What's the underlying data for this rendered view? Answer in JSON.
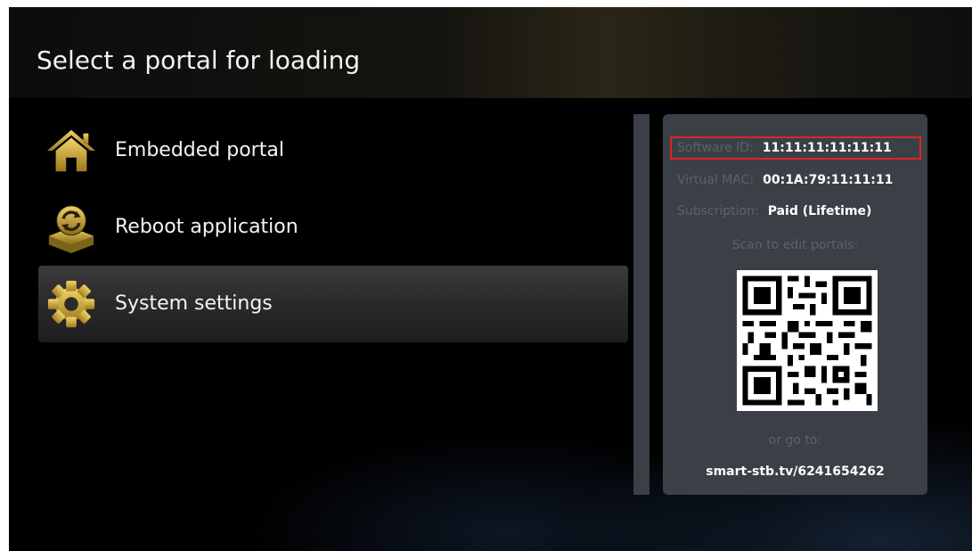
{
  "header": {
    "title": "Select a portal for loading"
  },
  "menu": {
    "items": [
      {
        "label": "Embedded portal",
        "icon": "home-icon",
        "selected": false
      },
      {
        "label": "Reboot application",
        "icon": "reboot-icon",
        "selected": false
      },
      {
        "label": "System settings",
        "icon": "gear-icon",
        "selected": true
      }
    ]
  },
  "info": {
    "software_id_label": "Software ID:",
    "software_id": "11:11:11:11:11:11",
    "virtual_mac_label": "Virtual MAC:",
    "virtual_mac": "00:1A:79:11:11:11",
    "subscription_label": "Subscription:",
    "subscription": "Paid (Lifetime)",
    "scan_text": "Scan to edit portals:",
    "or_text": "or go to:",
    "url": "smart-stb.tv/6241654262"
  },
  "colors": {
    "accent_gold": "#c9a227",
    "highlight_red": "#e0242a",
    "panel": "#3b3f46"
  }
}
